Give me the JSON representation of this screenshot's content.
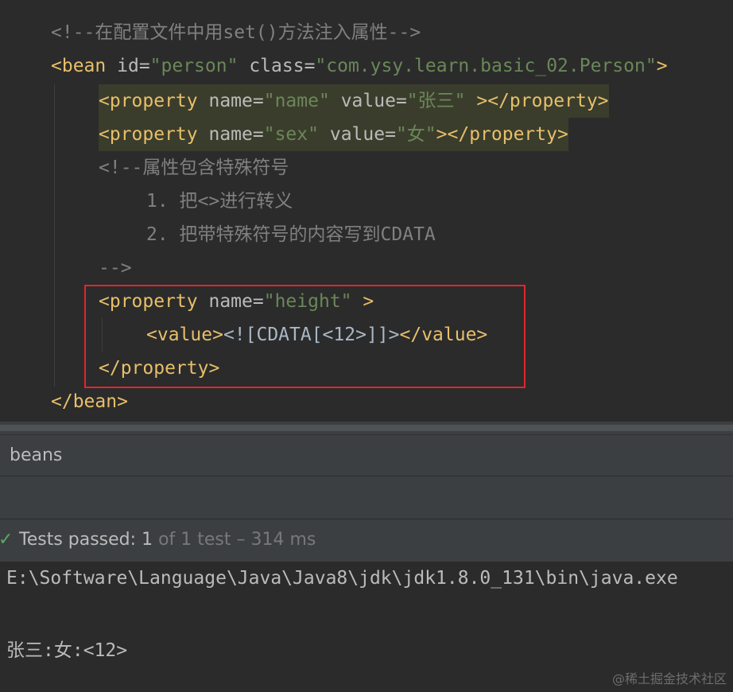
{
  "editor": {
    "lines": {
      "l1": {
        "comment": "<!--在配置文件中用set()方法注入属性-->"
      },
      "l2": {
        "open": "<bean",
        "attr1": "id",
        "eq1": "=",
        "val1": "\"person\"",
        "attr2": "class",
        "eq2": "=",
        "val2": "\"com.ysy.learn.basic_02.Person\"",
        "close": ">"
      },
      "l3": {
        "open": "<property",
        "attr1": "name",
        "eq1": "=",
        "val1": "\"name\"",
        "attr2": "value",
        "eq2": "=",
        "val2": "\"张三\"",
        "close": "></property>"
      },
      "l4": {
        "open": "<property",
        "attr1": "name",
        "eq1": "=",
        "val1": "\"sex\"",
        "attr2": "value",
        "eq2": "=",
        "val2": "\"女\"",
        "close": "></property>"
      },
      "l5": {
        "comment": "<!--属性包含特殊符号"
      },
      "l6": {
        "comment": "1. 把<>进行转义"
      },
      "l7": {
        "comment": "2. 把带特殊符号的内容写到CDATA"
      },
      "l8": {
        "comment": "-->"
      },
      "l9": {
        "open": "<property",
        "attr1": "name",
        "eq1": "=",
        "val1": "\"height\"",
        "close": ">"
      },
      "l10": {
        "open": "<value>",
        "text": "<![CDATA[<12>]]>",
        "close": "</value>"
      },
      "l11": {
        "close": "</property>"
      },
      "l12": {
        "close": "</bean>"
      }
    }
  },
  "panel": {
    "title": "beans"
  },
  "status": {
    "passed": "Tests passed:",
    "count": "1",
    "of": "of 1 test – 314 ms"
  },
  "console": {
    "command": "E:\\Software\\Language\\Java\\Java8\\jdk\\jdk1.8.0_131\\bin\\java.exe",
    "output": "张三:女:<12>"
  },
  "watermark": "@稀土掘金技术社区"
}
